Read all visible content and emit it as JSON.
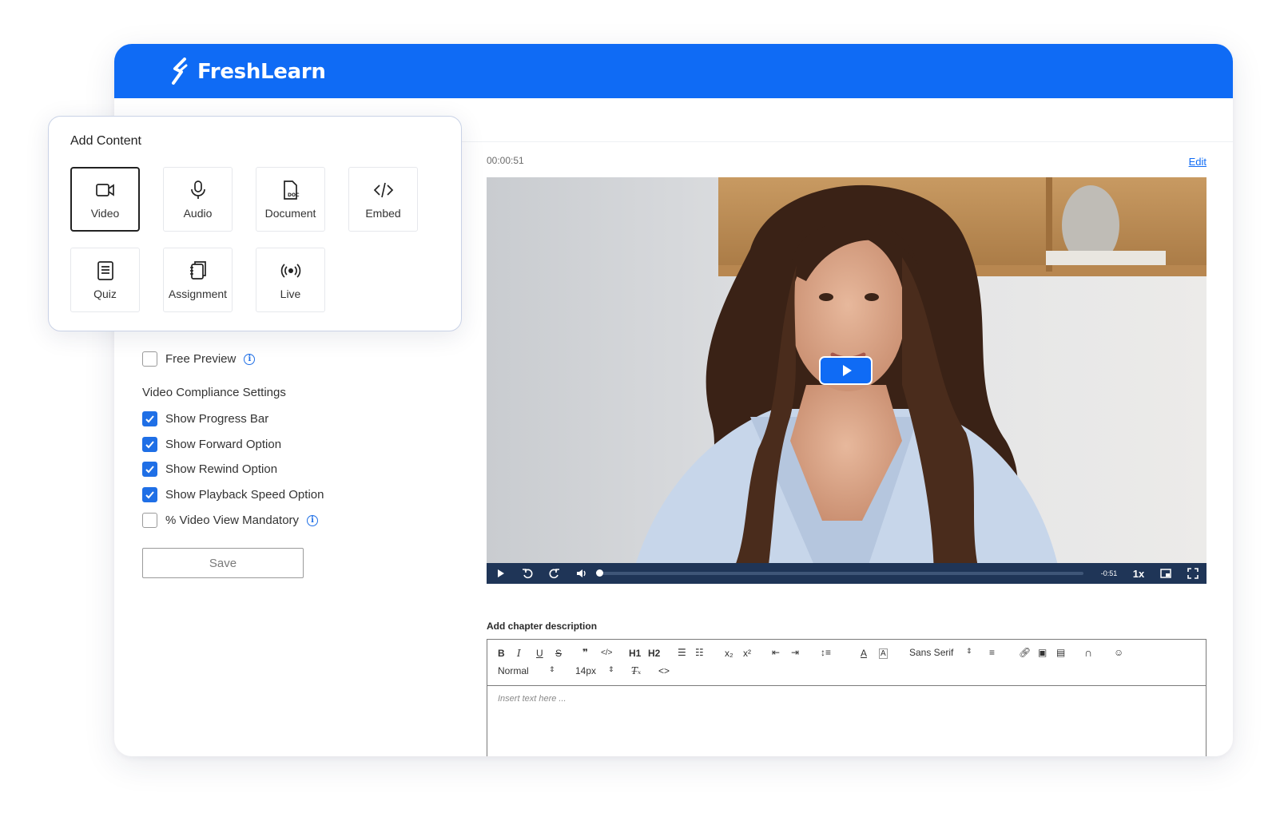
{
  "header": {
    "brand": "FreshLearn",
    "accent": "#0f6bf5"
  },
  "player": {
    "timecode": "00:00:51",
    "edit_label": "Edit",
    "time_remaining": "-0:51",
    "speed": "1x",
    "progress": 0.0
  },
  "description": {
    "label": "Add chapter description",
    "toolbar": {
      "bold": "B",
      "italic": "I",
      "underline": "U",
      "strike": "S",
      "h1": "H1",
      "h2": "H2",
      "font_family": "Sans Serif",
      "block_format": "Normal",
      "font_size": "14px"
    },
    "placeholder": "Insert text here ..."
  },
  "add_content": {
    "title": "Add Content",
    "items": [
      {
        "label": "Video",
        "icon": "video-icon",
        "selected": true
      },
      {
        "label": "Audio",
        "icon": "microphone-icon"
      },
      {
        "label": "Document",
        "icon": "document-icon"
      },
      {
        "label": "Embed",
        "icon": "code-icon"
      },
      {
        "label": "Quiz",
        "icon": "quiz-icon"
      },
      {
        "label": "Assignment",
        "icon": "assignment-icon"
      },
      {
        "label": "Live",
        "icon": "live-broadcast-icon"
      }
    ]
  },
  "settings": {
    "free_preview": {
      "label": "Free Preview",
      "checked": false
    },
    "compliance_title": "Video Compliance Settings",
    "options": [
      {
        "label": "Show Progress Bar",
        "checked": true
      },
      {
        "label": "Show Forward Option",
        "checked": true
      },
      {
        "label": "Show Rewind Option",
        "checked": true
      },
      {
        "label": "Show Playback Speed Option",
        "checked": true
      },
      {
        "label": "% Video View Mandatory",
        "checked": false
      }
    ],
    "save_label": "Save"
  }
}
